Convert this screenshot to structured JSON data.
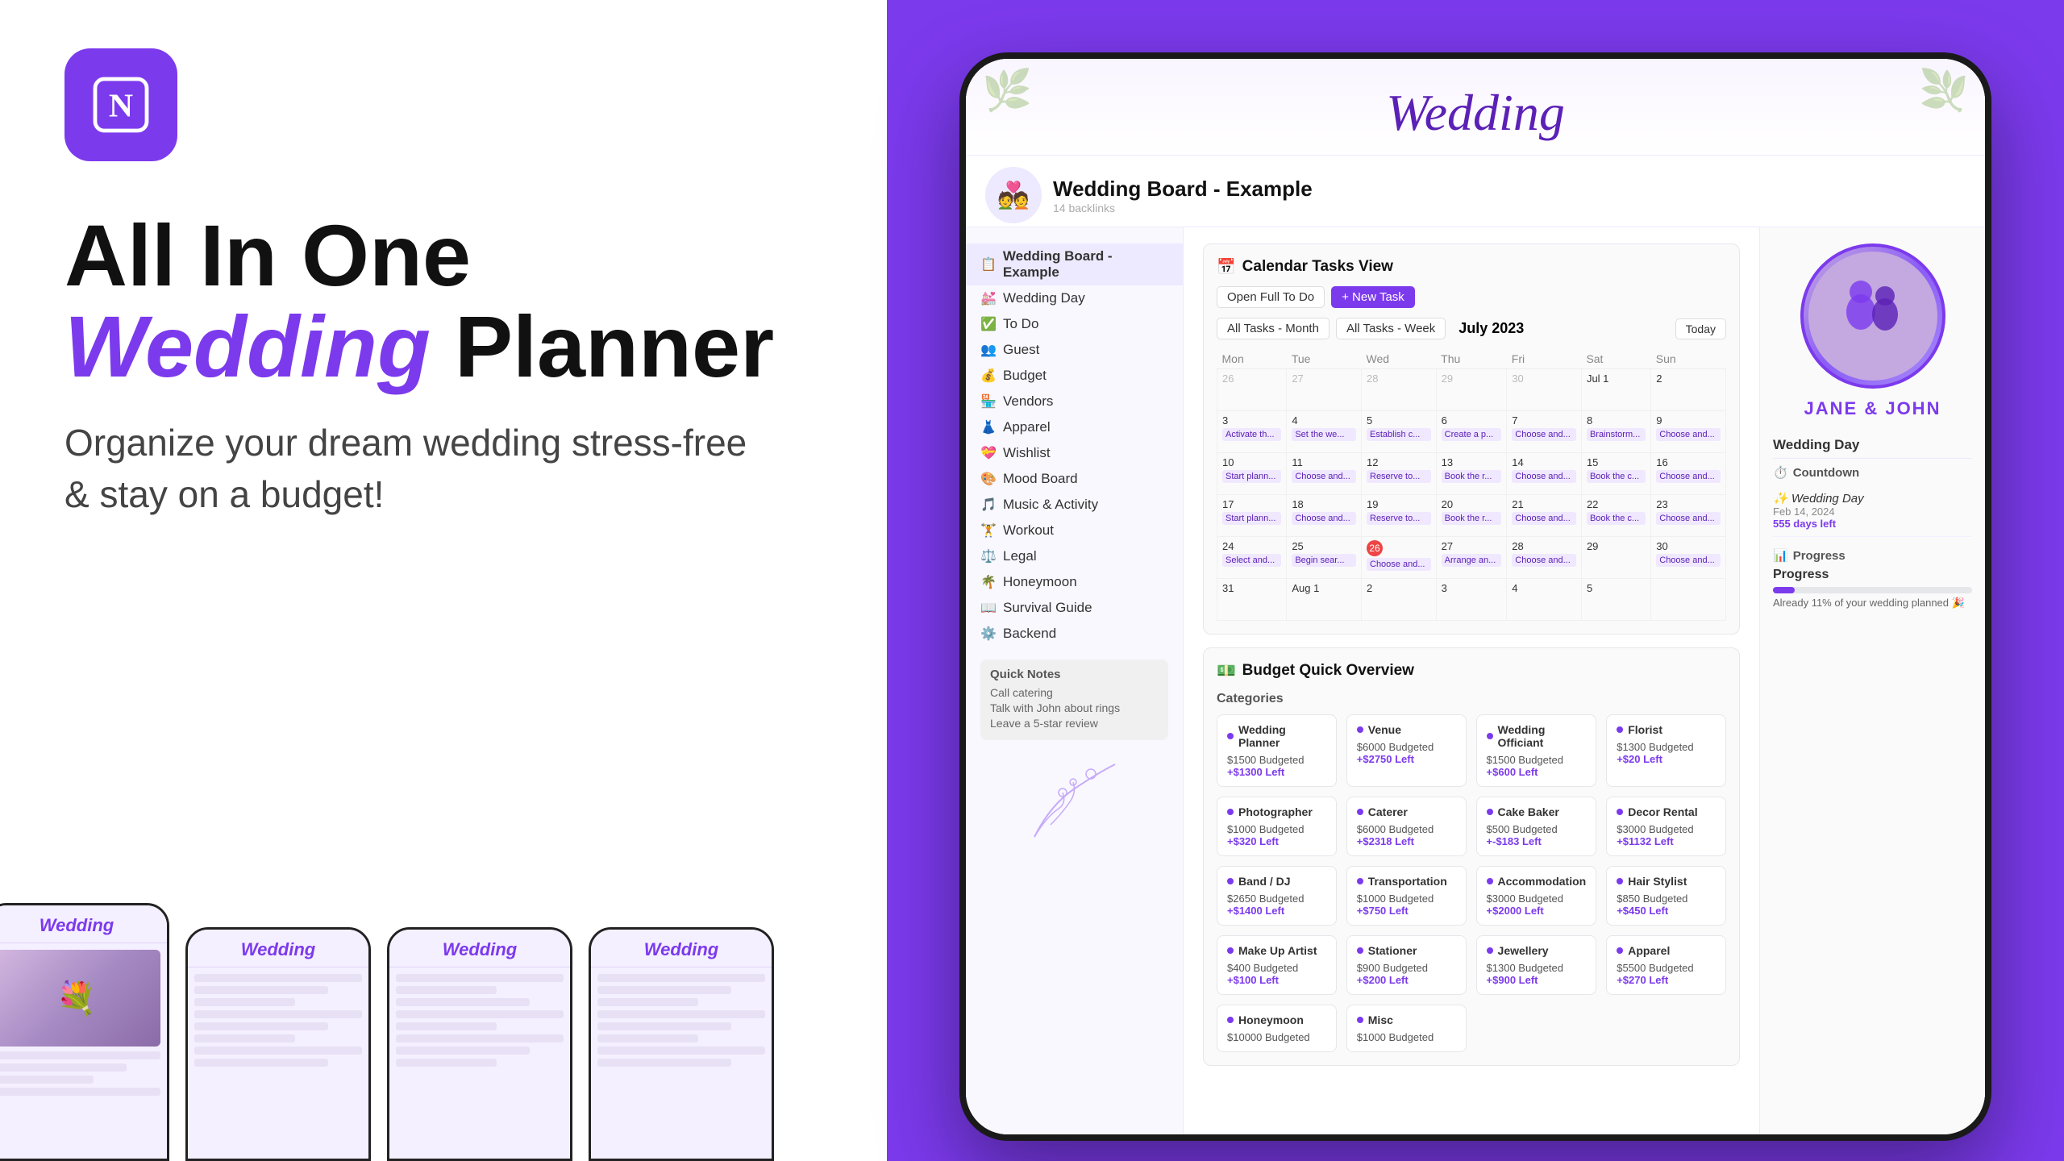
{
  "top_bar": {
    "color": "#7c3aed"
  },
  "left": {
    "logo_alt": "Notion logo",
    "headline_line1": "All In One",
    "headline_purple": "Wedding",
    "headline_line2": "Planner",
    "subheadline": "Organize your dream wedding stress-free & stay on a budget!"
  },
  "phone": {
    "wedding_title": "Wedding",
    "page_title": "Wedding Board - Example",
    "page_subtitle": "14 backlinks",
    "sidebar_items": [
      {
        "icon": "📋",
        "label": "Wedding Board - Example",
        "active": true
      },
      {
        "icon": "💒",
        "label": "Wedding Day"
      },
      {
        "icon": "✅",
        "label": "To Do"
      },
      {
        "icon": "👥",
        "label": "Guest"
      },
      {
        "icon": "💰",
        "label": "Budget"
      },
      {
        "icon": "🏪",
        "label": "Vendors"
      },
      {
        "icon": "👗",
        "label": "Apparel"
      },
      {
        "icon": "💝",
        "label": "Wishlist"
      },
      {
        "icon": "🎨",
        "label": "Mood Board"
      },
      {
        "icon": "🎵",
        "label": "Music & Activity"
      },
      {
        "icon": "🏋️",
        "label": "Workout"
      },
      {
        "icon": "⚖️",
        "label": "Legal"
      },
      {
        "icon": "🌴",
        "label": "Honeymoon"
      },
      {
        "icon": "📖",
        "label": "Survival Guide"
      },
      {
        "icon": "⚙️",
        "label": "Backend"
      }
    ],
    "quick_notes_title": "Quick Notes",
    "quick_notes": [
      "Call catering",
      "Talk with John about rings",
      "Leave a 5-star review"
    ],
    "calendar": {
      "title": "Calendar Tasks View",
      "month": "July 2023",
      "view_all": "Open Full To Do",
      "new_task": "+ New Task",
      "tab_month": "All Tasks - Month",
      "tab_week": "All Tasks - Week",
      "today_btn": "Today",
      "days": [
        "Mon",
        "Tue",
        "Wed",
        "Thu",
        "Fri",
        "Sat",
        "Sun"
      ],
      "weeks": [
        {
          "dates": [
            "26",
            "27",
            "28",
            "29",
            "30",
            "Jul 1",
            "2"
          ],
          "events": [
            [],
            [],
            [],
            [],
            [],
            [],
            []
          ]
        },
        {
          "dates": [
            "3",
            "4",
            "5",
            "6",
            "7",
            "8",
            "9"
          ],
          "events": [
            [
              "Activate th..."
            ],
            [
              "Set the we..."
            ],
            [
              "Establish c..."
            ],
            [
              "Create a p..."
            ],
            [
              "Choose and..."
            ],
            [
              "Brainstorm..."
            ],
            [
              "Choose and..."
            ]
          ]
        },
        {
          "dates": [
            "10",
            "11",
            "12",
            "13",
            "14",
            "15",
            "16"
          ],
          "events": [
            [
              "Start plann..."
            ],
            [
              "Choose and..."
            ],
            [
              "Reserve to..."
            ],
            [
              "Book the r..."
            ],
            [
              "Choose and..."
            ],
            [
              "Book the c..."
            ],
            [
              "Choose and..."
            ]
          ]
        },
        {
          "dates": [
            "17",
            "18",
            "19",
            "20",
            "21",
            "22",
            "23"
          ],
          "events": [
            [
              "Start plann..."
            ],
            [
              "Choose and..."
            ],
            [
              "Reserve to..."
            ],
            [
              "Book the r..."
            ],
            [
              "Choose and..."
            ],
            [
              "Book the c..."
            ],
            [
              "Choose and..."
            ]
          ]
        },
        {
          "dates": [
            "24",
            "25",
            "26",
            "27",
            "28",
            "29",
            "30"
          ],
          "today_idx": 2,
          "events": [
            [
              "Select and..."
            ],
            [
              "Begin sear..."
            ],
            [
              "Choose and..."
            ],
            [
              "Arrange an..."
            ],
            [
              "Choose and..."
            ],
            [
              ""
            ],
            [
              "Choose and..."
            ]
          ]
        },
        {
          "dates": [
            "31",
            "Aug 1",
            "2",
            "3",
            "4",
            "5",
            ""
          ],
          "events": [
            [],
            [],
            [],
            [],
            [],
            [],
            []
          ]
        }
      ]
    },
    "couple": {
      "names": "JANE & JOHN",
      "wedding_day_label": "Wedding Day",
      "countdown_label": "✨ Wedding Day",
      "countdown_date": "Feb 14, 2024",
      "countdown_days": "555 days left",
      "progress_title": "Progress",
      "progress_label": "Progress",
      "progress_text": "Already 11% of your wedding planned 🎉",
      "progress_pct": 11
    },
    "budget": {
      "title": "Budget Quick Overview",
      "categories_label": "Categories",
      "items": [
        {
          "name": "Wedding Planner",
          "budgeted": "$1500 Budgeted",
          "left": "+$1300 Left"
        },
        {
          "name": "Venue",
          "budgeted": "$6000 Budgeted",
          "left": "+$2750 Left"
        },
        {
          "name": "Wedding Officiant",
          "budgeted": "$1500 Budgeted",
          "left": "+$600 Left"
        },
        {
          "name": "Florist",
          "budgeted": "$1300 Budgeted",
          "left": "+$20 Left"
        },
        {
          "name": "Photographer",
          "budgeted": "$1000 Budgeted",
          "left": "+$320 Left"
        },
        {
          "name": "Caterer",
          "budgeted": "$6000 Budgeted",
          "left": "+$2318 Left"
        },
        {
          "name": "Cake Baker",
          "budgeted": "$500 Budgeted",
          "left": "+-$183 Left"
        },
        {
          "name": "Decor Rental",
          "budgeted": "$3000 Budgeted",
          "left": "+$1132 Left"
        },
        {
          "name": "Band / DJ",
          "budgeted": "$2650 Budgeted",
          "left": "+$1400 Left"
        },
        {
          "name": "Transportation",
          "budgeted": "$1000 Budgeted",
          "left": "+$750 Left"
        },
        {
          "name": "Accommodation",
          "budgeted": "$3000 Budgeted",
          "left": "+$2000 Left"
        },
        {
          "name": "Hair Stylist",
          "budgeted": "$850 Budgeted",
          "left": "+$450 Left"
        },
        {
          "name": "Make Up Artist",
          "budgeted": "$400 Budgeted",
          "left": "+$100 Left"
        },
        {
          "name": "Stationer",
          "budgeted": "$900 Budgeted",
          "left": "+$200 Left"
        },
        {
          "name": "Jewellery",
          "budgeted": "$1300 Budgeted",
          "left": "+$900 Left"
        },
        {
          "name": "Apparel",
          "budgeted": "$5500 Budgeted",
          "left": "+$270 Left"
        },
        {
          "name": "Honeymoon",
          "budgeted": "$10000 Budgeted",
          "left": ""
        },
        {
          "name": "Misc",
          "budgeted": "$1000 Budgeted",
          "left": ""
        }
      ]
    }
  }
}
